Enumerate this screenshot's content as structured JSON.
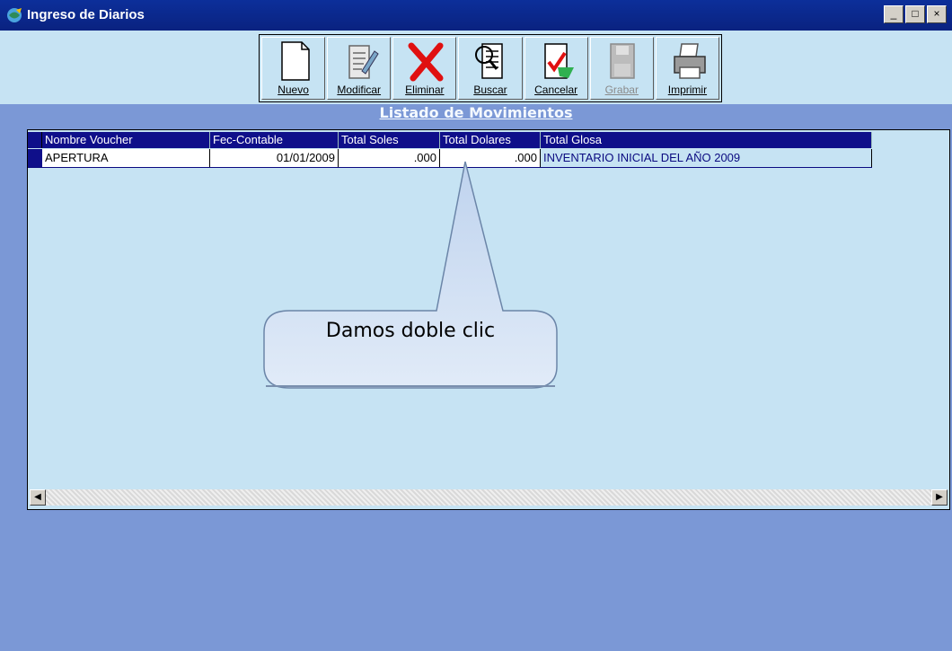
{
  "window": {
    "title": "Ingreso de Diarios",
    "controls": [
      "_",
      "□",
      "×"
    ]
  },
  "toolbar": {
    "buttons": [
      {
        "label": "Nuevo",
        "icon": "new-document-icon"
      },
      {
        "label": "Modificar",
        "icon": "edit-document-icon"
      },
      {
        "label": "Eliminar",
        "icon": "red-x-icon"
      },
      {
        "label": "Buscar",
        "icon": "magnifier-document-icon"
      },
      {
        "label": "Cancelar",
        "icon": "cancel-document-icon"
      },
      {
        "label": "Grabar",
        "icon": "save-disk-icon",
        "disabled": true
      },
      {
        "label": "Imprimir",
        "icon": "printer-icon"
      }
    ]
  },
  "list": {
    "title": "Listado de Movimientos",
    "columns": [
      "Nombre Voucher",
      "Fec-Contable",
      "Total Soles",
      "Total Dolares",
      "Total Glosa"
    ],
    "rows": [
      {
        "nombre": "APERTURA",
        "fecha": "01/01/2009",
        "soles": ".000",
        "dolares": ".000",
        "glosa": "INVENTARIO INICIAL DEL AÑO 2009"
      }
    ]
  },
  "callout": {
    "text": "Damos doble clic"
  },
  "colors": {
    "titlebar": "#0a2280",
    "panel": "#c6e3f3",
    "background": "#7b98d6",
    "header": "#0f0f8a"
  }
}
